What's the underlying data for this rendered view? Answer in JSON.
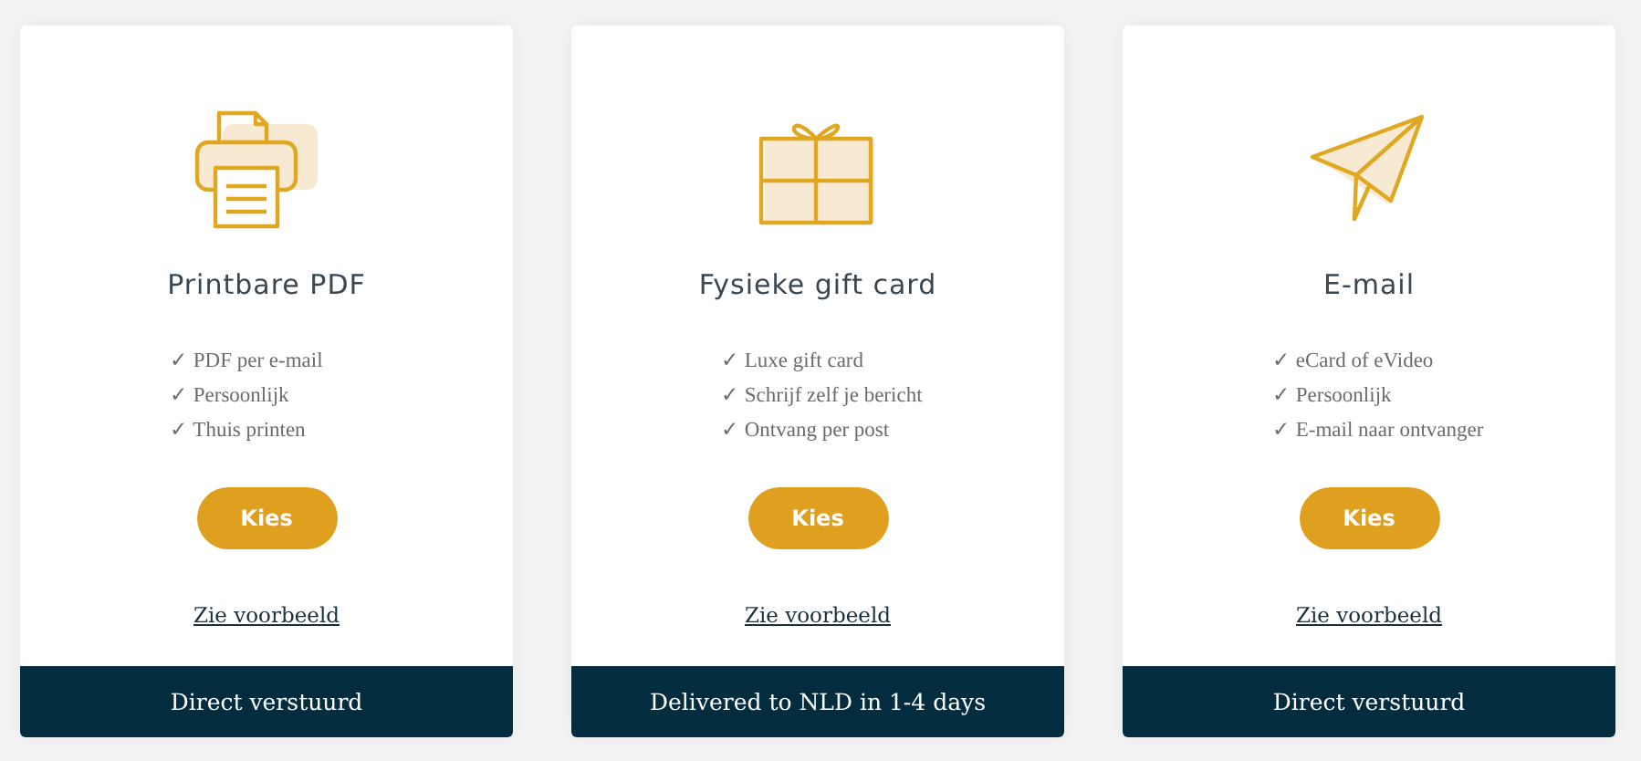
{
  "cards": [
    {
      "kind": "printer",
      "title": "Printbare PDF",
      "features": [
        "✓ PDF per e-mail",
        "✓ Persoonlijk",
        "✓ Thuis printen"
      ],
      "button": "Kies",
      "link": "Zie voorbeeld",
      "footer": "Direct verstuurd"
    },
    {
      "kind": "gift",
      "title": "Fysieke gift card",
      "features": [
        "✓ Luxe gift card",
        "✓ Schrijf zelf je bericht",
        "✓ Ontvang per post"
      ],
      "button": "Kies",
      "link": "Zie voorbeeld",
      "footer": "Delivered to NLD in 1-4 days"
    },
    {
      "kind": "plane",
      "title": "E-mail",
      "features": [
        "✓ eCard of eVideo",
        "✓ Persoonlijk",
        "✓ E-mail naar ontvanger"
      ],
      "button": "Kies",
      "link": "Zie voorbeeld",
      "footer": "Direct verstuurd"
    }
  ]
}
